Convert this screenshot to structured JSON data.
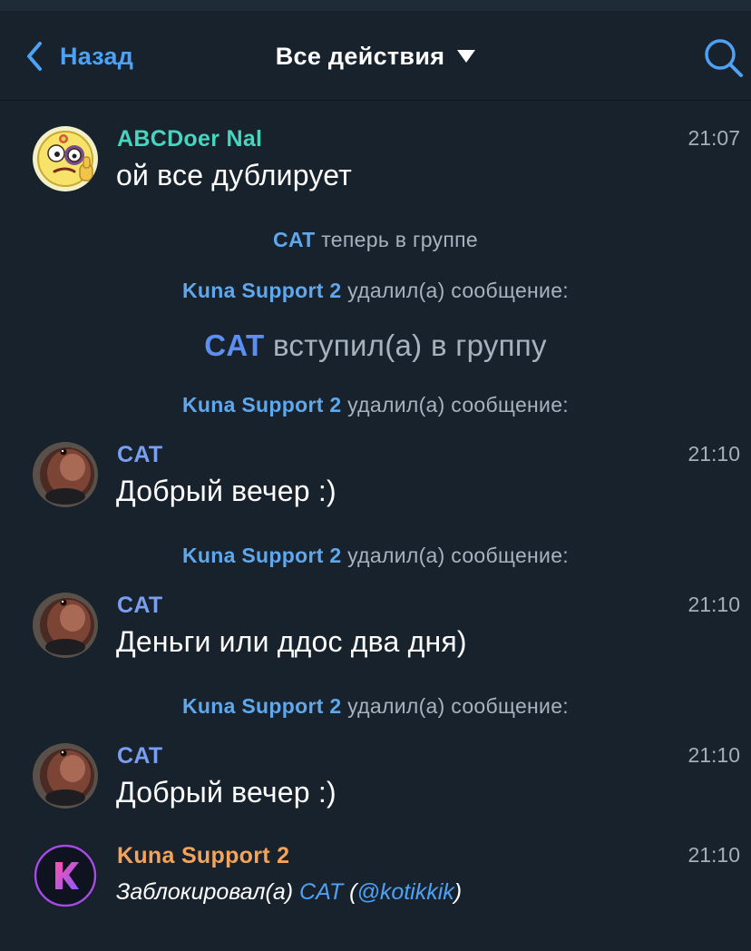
{
  "header": {
    "back_label": "Назад",
    "title": "Все действия",
    "icons": {
      "back": "chevron-left-icon",
      "dropdown": "caret-down-icon",
      "search": "search-icon"
    }
  },
  "colors": {
    "background": "#18222d",
    "accent_blue": "#4da2f6",
    "name_teal": "#46d6c0",
    "name_cat": "#7b9ff0",
    "name_kuna": "#f4a35a",
    "service_text": "#a6b3bf"
  },
  "feed": {
    "msg1": {
      "author": "ABCDoer Nal",
      "time": "21:07",
      "text": "ой все дублирует"
    },
    "svc1": {
      "who": "CAT",
      "what": "теперь в группе"
    },
    "svc2": {
      "who": "Kuna Support 2",
      "what": "удалил(а) сообщение:"
    },
    "svc3": {
      "who": "CAT",
      "what": "вступил(а) в группу"
    },
    "svc4": {
      "who": "Kuna Support 2",
      "what": "удалил(а) сообщение:"
    },
    "msg2": {
      "author": "CAT",
      "time": "21:10",
      "text": "Добрый вечер :)"
    },
    "svc5": {
      "who": "Kuna Support 2",
      "what": "удалил(а) сообщение:"
    },
    "msg3": {
      "author": "CAT",
      "time": "21:10",
      "text": "Деньги или ддос два дня)"
    },
    "svc6": {
      "who": "Kuna Support 2",
      "what": "удалил(а) сообщение:"
    },
    "msg4": {
      "author": "CAT",
      "time": "21:10",
      "text": "Добрый вечер :)"
    },
    "msg5": {
      "author": "Kuna Support 2",
      "time": "21:10",
      "action": "Заблокировал(а)",
      "target": "CAT",
      "open_paren": "(",
      "handle": "@kotikkik",
      "close_paren": ")"
    }
  }
}
